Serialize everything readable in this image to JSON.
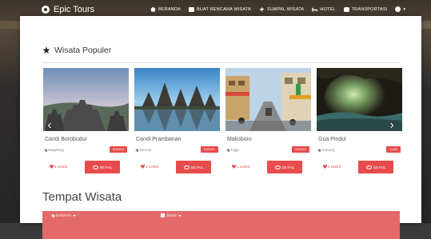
{
  "brand": {
    "name": "Epic Tours"
  },
  "nav": [
    {
      "label": "BERANDA",
      "icon": "home-icon"
    },
    {
      "label": "BUAT RENCANA WISATA",
      "icon": "plan-icon"
    },
    {
      "label": "SUMPAL WISATA",
      "icon": "plane-icon"
    },
    {
      "label": "HOTEL",
      "icon": "bed-icon"
    },
    {
      "label": "TRANSPORTASI",
      "icon": "bus-icon"
    },
    {
      "label": "▾",
      "icon": "user-icon"
    }
  ],
  "popular": {
    "title": "Wisata Populer",
    "cards": [
      {
        "name": "Candi Borobudur",
        "location": "Magelang",
        "category": "BUDAYA",
        "likes": "3 LIKES",
        "detail": "DETAIL"
      },
      {
        "name": "Candi Prambanan",
        "location": "Sleman",
        "category": "BUDAYA",
        "likes": "1 LIKES",
        "detail": "DETAIL"
      },
      {
        "name": "Malioboro",
        "location": "Jogja",
        "category": "BUDAYA",
        "likes": "1 LIKES",
        "detail": "DETAIL"
      },
      {
        "name": "Gua Pindul",
        "location": "Gunung",
        "category": "ALAM",
        "likes": "1 LIKES",
        "detail": "DETAIL"
      }
    ]
  },
  "places": {
    "title": "Tempat Wisata",
    "filters": [
      {
        "label": "DAERAH"
      },
      {
        "label": "JENIS"
      }
    ]
  },
  "colors": {
    "accent": "#e84b4b",
    "filter_bar": "#e46a6a"
  }
}
